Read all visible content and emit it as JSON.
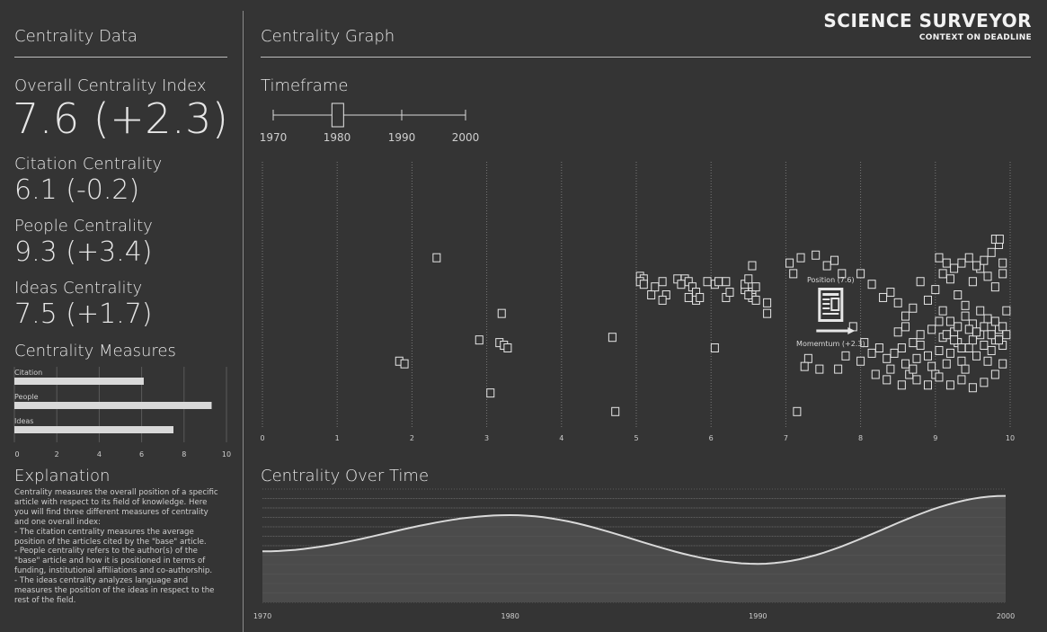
{
  "brand": {
    "title": "SCIENCE SURVEYOR",
    "subtitle": "CONTEXT ON DEADLINE"
  },
  "left": {
    "header": "Centrality Data",
    "overall": {
      "label": "Overall Centrality Index",
      "value": "7.6 (+2.3)"
    },
    "citation": {
      "label": "Citation Centrality",
      "value": "6.1 (-0.2)"
    },
    "people": {
      "label": "People Centrality",
      "value": "9.3 (+3.4)"
    },
    "ideas": {
      "label": "Ideas Centrality",
      "value": "7.5 (+1.7)"
    },
    "measures_title": "Centrality Measures",
    "explanation_title": "Explanation",
    "explanation_lines": [
      "Centrality measures the overall position of a specific",
      "article with respect to its field of knowledge. Here",
      "you will find three different measures of centrality",
      "and one overall index:",
      "- The citation centrality measures the average",
      "position of the articles cited by the \"base\" article.",
      "- People centrality refers to the author(s) of the",
      "\"base\" article and how it is positioned in terms of",
      "funding, institutional affiliations and co-authorship.",
      "- The ideas centrality analyzes language and",
      "measures the position of the ideas in respect to the",
      "rest of the field."
    ]
  },
  "main": {
    "graph_title": "Centrality Graph",
    "timeframe_label": "Timeframe",
    "timeframe_ticks": [
      "1970",
      "1980",
      "1990",
      "2000"
    ],
    "timeframe_selected": 1980,
    "position_label": "Position (7.6)",
    "momentum_label": "Momemtum (+2.3)",
    "over_time_title": "Centrality Over Time"
  },
  "chart_data": [
    {
      "type": "bar",
      "title": "Centrality Measures",
      "categories": [
        "Citation",
        "People",
        "Ideas"
      ],
      "values": [
        6.1,
        9.3,
        7.5
      ],
      "xlim": [
        0,
        10
      ],
      "ticks": [
        "0",
        "2",
        "4",
        "6",
        "8",
        "10"
      ],
      "grid": true,
      "colors": {
        "bar": "#d9d9d9"
      }
    },
    {
      "type": "scatter",
      "title": "Centrality Graph",
      "xlim": [
        0,
        10
      ],
      "ticks": [
        "0",
        "1",
        "2",
        "3",
        "4",
        "5",
        "6",
        "7",
        "8",
        "9",
        "10"
      ],
      "base_article": {
        "x": 7.6,
        "momentum": 2.3
      },
      "points": [
        [
          2.33,
          0.64
        ],
        [
          1.83,
          0.25
        ],
        [
          1.9,
          0.24
        ],
        [
          3.05,
          0.13
        ],
        [
          2.9,
          0.33
        ],
        [
          3.2,
          0.43
        ],
        [
          3.17,
          0.32
        ],
        [
          3.23,
          0.31
        ],
        [
          3.28,
          0.3
        ],
        [
          4.68,
          0.34
        ],
        [
          4.72,
          0.06
        ],
        [
          6.05,
          0.3
        ],
        [
          5.05,
          0.57
        ],
        [
          5.1,
          0.56
        ],
        [
          5.05,
          0.55
        ],
        [
          5.1,
          0.54
        ],
        [
          5.2,
          0.5
        ],
        [
          5.25,
          0.53
        ],
        [
          5.35,
          0.55
        ],
        [
          5.4,
          0.5
        ],
        [
          5.35,
          0.48
        ],
        [
          5.55,
          0.56
        ],
        [
          5.65,
          0.56
        ],
        [
          5.6,
          0.54
        ],
        [
          5.7,
          0.55
        ],
        [
          5.75,
          0.53
        ],
        [
          5.8,
          0.51
        ],
        [
          5.7,
          0.49
        ],
        [
          5.8,
          0.48
        ],
        [
          5.85,
          0.49
        ],
        [
          5.95,
          0.55
        ],
        [
          6.05,
          0.54
        ],
        [
          6.1,
          0.55
        ],
        [
          6.2,
          0.55
        ],
        [
          6.2,
          0.49
        ],
        [
          6.25,
          0.51
        ],
        [
          6.45,
          0.52
        ],
        [
          6.45,
          0.54
        ],
        [
          6.5,
          0.56
        ],
        [
          6.55,
          0.51
        ],
        [
          6.55,
          0.49
        ],
        [
          6.5,
          0.5
        ],
        [
          6.6,
          0.48
        ],
        [
          6.6,
          0.53
        ],
        [
          6.55,
          0.61
        ],
        [
          6.75,
          0.47
        ],
        [
          6.75,
          0.43
        ],
        [
          7.05,
          0.62
        ],
        [
          7.1,
          0.58
        ],
        [
          7.2,
          0.64
        ],
        [
          7.4,
          0.65
        ],
        [
          7.55,
          0.61
        ],
        [
          7.65,
          0.63
        ],
        [
          7.75,
          0.58
        ],
        [
          7.15,
          0.06
        ],
        [
          7.3,
          0.26
        ],
        [
          7.25,
          0.23
        ],
        [
          7.45,
          0.22
        ],
        [
          7.7,
          0.22
        ],
        [
          7.8,
          0.27
        ],
        [
          7.9,
          0.38
        ],
        [
          8.0,
          0.25
        ],
        [
          8.05,
          0.32
        ],
        [
          8.15,
          0.28
        ],
        [
          8.25,
          0.3
        ],
        [
          8.35,
          0.26
        ],
        [
          8.4,
          0.22
        ],
        [
          8.45,
          0.28
        ],
        [
          8.55,
          0.3
        ],
        [
          8.6,
          0.24
        ],
        [
          8.65,
          0.2
        ],
        [
          8.7,
          0.22
        ],
        [
          8.75,
          0.26
        ],
        [
          8.8,
          0.31
        ],
        [
          8.9,
          0.27
        ],
        [
          8.95,
          0.23
        ],
        [
          9.0,
          0.2
        ],
        [
          9.05,
          0.29
        ],
        [
          9.1,
          0.34
        ],
        [
          9.15,
          0.24
        ],
        [
          9.2,
          0.28
        ],
        [
          9.25,
          0.36
        ],
        [
          9.3,
          0.32
        ],
        [
          9.35,
          0.25
        ],
        [
          9.4,
          0.22
        ],
        [
          9.45,
          0.3
        ],
        [
          9.5,
          0.33
        ],
        [
          9.55,
          0.27
        ],
        [
          9.6,
          0.35
        ],
        [
          9.65,
          0.31
        ],
        [
          9.7,
          0.25
        ],
        [
          9.75,
          0.29
        ],
        [
          9.8,
          0.33
        ],
        [
          9.85,
          0.37
        ],
        [
          9.9,
          0.31
        ],
        [
          8.0,
          0.58
        ],
        [
          8.15,
          0.54
        ],
        [
          8.3,
          0.49
        ],
        [
          8.4,
          0.51
        ],
        [
          8.5,
          0.47
        ],
        [
          8.6,
          0.42
        ],
        [
          8.7,
          0.45
        ],
        [
          8.8,
          0.55
        ],
        [
          8.9,
          0.48
        ],
        [
          9.0,
          0.52
        ],
        [
          9.1,
          0.58
        ],
        [
          9.2,
          0.56
        ],
        [
          9.3,
          0.5
        ],
        [
          9.4,
          0.46
        ],
        [
          9.5,
          0.55
        ],
        [
          9.6,
          0.6
        ],
        [
          9.7,
          0.57
        ],
        [
          9.8,
          0.53
        ],
        [
          9.9,
          0.58
        ],
        [
          9.95,
          0.44
        ],
        [
          9.15,
          0.62
        ],
        [
          9.05,
          0.64
        ],
        [
          9.25,
          0.6
        ],
        [
          9.35,
          0.62
        ],
        [
          9.45,
          0.64
        ],
        [
          9.55,
          0.61
        ],
        [
          9.65,
          0.63
        ],
        [
          9.75,
          0.66
        ],
        [
          9.85,
          0.69
        ],
        [
          9.8,
          0.71
        ],
        [
          9.86,
          0.71
        ],
        [
          9.9,
          0.62
        ],
        [
          9.1,
          0.44
        ],
        [
          9.2,
          0.4
        ],
        [
          9.3,
          0.38
        ],
        [
          9.4,
          0.42
        ],
        [
          9.5,
          0.39
        ],
        [
          9.6,
          0.44
        ],
        [
          9.7,
          0.41
        ],
        [
          9.8,
          0.4
        ],
        [
          9.9,
          0.38
        ],
        [
          8.5,
          0.36
        ],
        [
          8.6,
          0.38
        ],
        [
          8.7,
          0.32
        ],
        [
          8.8,
          0.35
        ],
        [
          8.95,
          0.37
        ],
        [
          9.05,
          0.4
        ],
        [
          9.15,
          0.35
        ],
        [
          9.25,
          0.33
        ],
        [
          9.35,
          0.3
        ],
        [
          9.45,
          0.37
        ],
        [
          9.55,
          0.36
        ],
        [
          9.65,
          0.38
        ],
        [
          9.75,
          0.35
        ],
        [
          9.85,
          0.33
        ],
        [
          9.95,
          0.35
        ],
        [
          8.2,
          0.2
        ],
        [
          8.35,
          0.18
        ],
        [
          8.55,
          0.16
        ],
        [
          8.75,
          0.18
        ],
        [
          8.9,
          0.16
        ],
        [
          9.05,
          0.19
        ],
        [
          9.2,
          0.16
        ],
        [
          9.35,
          0.18
        ],
        [
          9.5,
          0.15
        ],
        [
          9.65,
          0.17
        ],
        [
          9.8,
          0.2
        ],
        [
          9.9,
          0.24
        ]
      ]
    },
    {
      "type": "area",
      "title": "Centrality Over Time",
      "x": [
        1970,
        1980,
        1990,
        2000
      ],
      "ticks": [
        "1970",
        "1980",
        "1990",
        "2000"
      ],
      "points": [
        [
          1970,
          0.45
        ],
        [
          1980,
          0.77
        ],
        [
          1990,
          0.34
        ],
        [
          2000,
          0.94
        ]
      ],
      "ylim": [
        0,
        1
      ]
    }
  ]
}
